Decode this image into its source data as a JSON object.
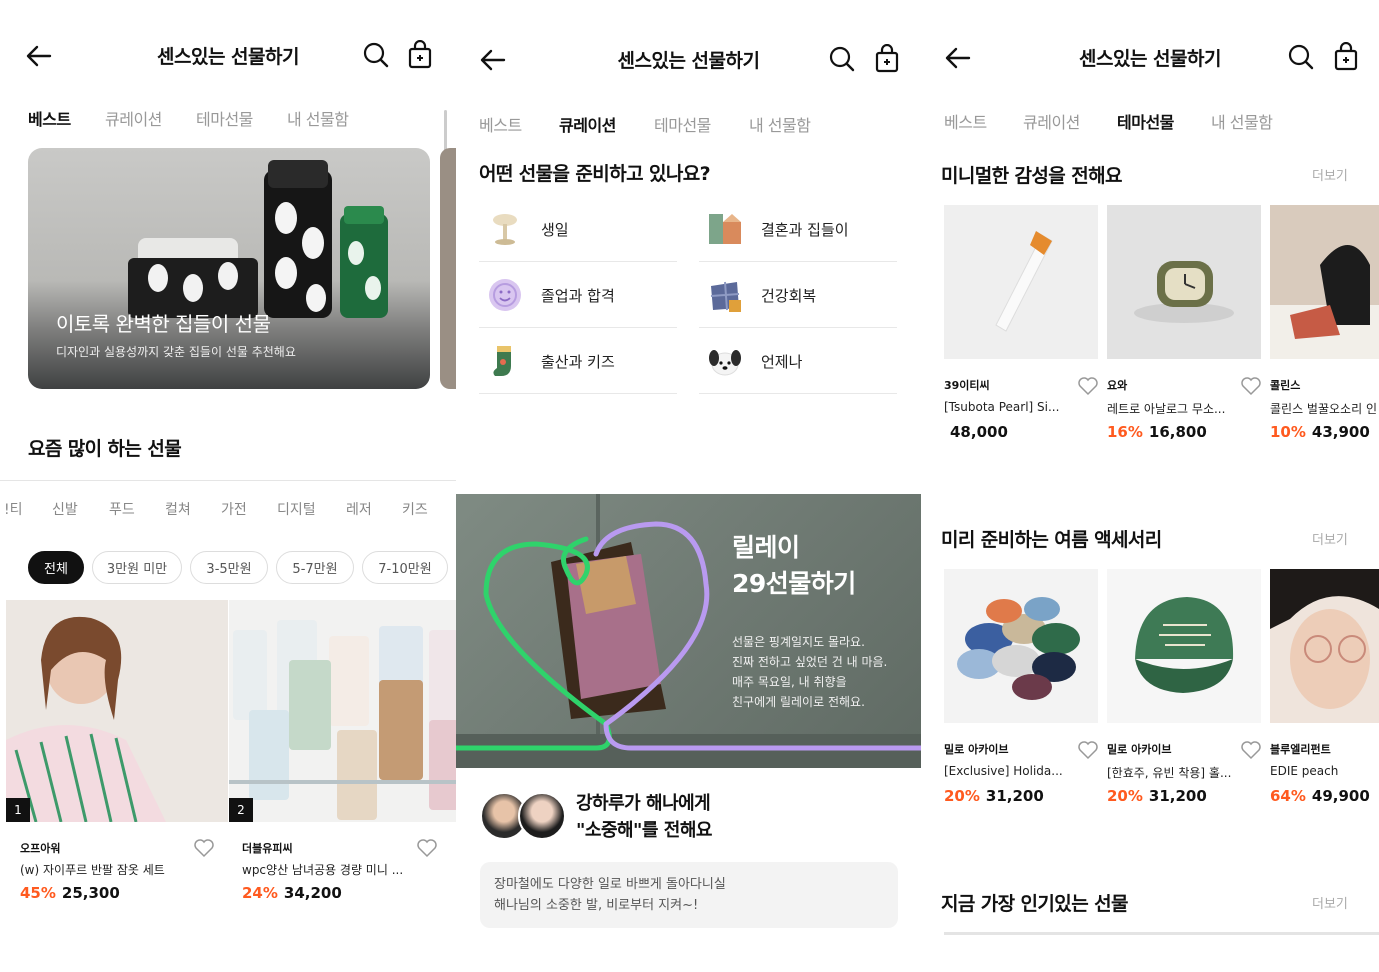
{
  "header": {
    "title": "센스있는 선물하기"
  },
  "tabs": [
    "베스트",
    "큐레이션",
    "테마선물",
    "내 선물함"
  ],
  "best": {
    "hero_title": "이토록 완벽한 집들이 선물",
    "hero_subtitle": "디자인과 실용성까지 갖춘 집들이 선물 추천해요",
    "section_title": "요즘 많이 하는 선물",
    "categories": [
      "!티",
      "신발",
      "푸드",
      "컬쳐",
      "가전",
      "디지털",
      "레저",
      "키즈"
    ],
    "price_chips": [
      "전체",
      "3만원 미만",
      "3-5만원",
      "5-7만원",
      "7-10만원"
    ],
    "products": [
      {
        "rank": "1",
        "brand": "오프아워",
        "name": "(w) 자이푸르 반팔 잠옷 세트",
        "discount": "45%",
        "price": "25,300"
      },
      {
        "rank": "2",
        "brand": "더블유피씨",
        "name": "wpc양산 남녀공용 경량 미니 ...",
        "discount": "24%",
        "price": "34,200"
      }
    ]
  },
  "curation": {
    "question": "어떤 선물을 준비하고 있나요?",
    "occasions": [
      {
        "label": "생일",
        "icon": "cake-stand-icon"
      },
      {
        "label": "결혼과 집들이",
        "icon": "wedding-gift-icon"
      },
      {
        "label": "졸업과 합격",
        "icon": "smile-badge-icon"
      },
      {
        "label": "건강회복",
        "icon": "wrapped-gift-icon"
      },
      {
        "label": "출산과 키즈",
        "icon": "baby-sock-icon"
      },
      {
        "label": "언제나",
        "icon": "puppy-icon"
      }
    ],
    "banner": {
      "title_line1": "릴레이",
      "title_line2": "29선물하기",
      "text": [
        "선물은 핑계일지도 몰라요.",
        "진짜 전하고 싶었던 건 내 마음.",
        "매주 목요일, 내 취향을",
        "친구에게 릴레이로 전해요."
      ]
    },
    "relay": {
      "title_line1": "강하루가 해나에게",
      "title_line2": "\"소중해\"를 전해요",
      "message_line1": "장마철에도 다양한 일로 바쁘게 돌아다니실",
      "message_line2": "해나님의 소중한 발, 비로부터 지켜~!"
    }
  },
  "theme": {
    "more_label": "더보기",
    "sections": [
      {
        "title": "미니멀한 감성을 전해요",
        "items": [
          {
            "brand": "39이티씨",
            "name": "[Tsubota Pearl] Si...",
            "discount": "",
            "price": "48,000"
          },
          {
            "brand": "요와",
            "name": "레트로 아날로그 무소...",
            "discount": "16%",
            "price": "16,800"
          },
          {
            "brand": "콜린스",
            "name": "콜린스 벌꿀오소리 인",
            "discount": "10%",
            "price": "43,900"
          }
        ]
      },
      {
        "title": "미리 준비하는 여름 액세서리",
        "items": [
          {
            "brand": "밀로 아카이브",
            "name": "[Exclusive] Holida...",
            "discount": "20%",
            "price": "31,200"
          },
          {
            "brand": "밀로 아카이브",
            "name": "[한효주, 유빈 착용] 홀...",
            "discount": "20%",
            "price": "31,200"
          },
          {
            "brand": "블루엘리펀트",
            "name": "EDIE peach",
            "discount": "64%",
            "price": "49,900"
          }
        ]
      },
      {
        "title": "지금 가장 인기있는 선물"
      }
    ]
  },
  "colors": {
    "accent_discount": "#ff5a1f",
    "relay_green": "#2fd36b",
    "relay_purple": "#b99af0"
  }
}
